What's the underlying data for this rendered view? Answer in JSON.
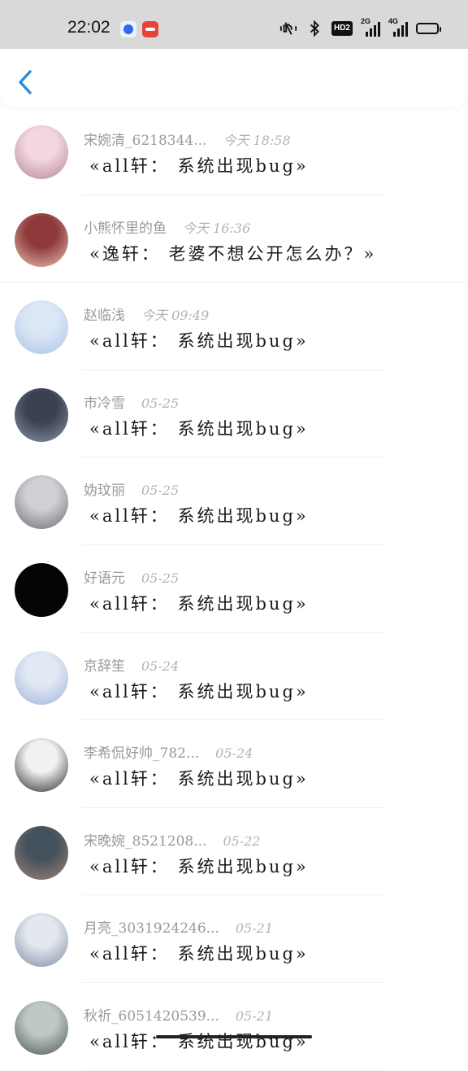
{
  "status": {
    "time": "22:02",
    "hd_label": "HD2",
    "net1_label": "2G",
    "net2_label": "4G"
  },
  "header": {
    "back_icon": "chevron-left-icon"
  },
  "items": [
    {
      "name": "宋婉清_6218344...",
      "time": "今天 18:58",
      "preview": "«all轩： 系统出现bug»",
      "avatar_colors": [
        "#f2d6e0",
        "#b58895"
      ]
    },
    {
      "name": "小熊怀里的鱼",
      "time": "今天 16:36",
      "preview": "«逸轩： 老婆不想公开怎么办？»",
      "avatar_colors": [
        "#8e3a3a",
        "#e9c3b5"
      ]
    },
    {
      "name": "赵临浅",
      "time": "今天 09:49",
      "preview": "«all轩： 系统出现bug»",
      "avatar_colors": [
        "#dbe7f7",
        "#aac4e6"
      ]
    },
    {
      "name": "市冷雪",
      "time": "05-25",
      "preview": "«all轩： 系统出现bug»",
      "avatar_colors": [
        "#3b4150",
        "#8895a6"
      ]
    },
    {
      "name": "妫玟丽",
      "time": "05-25",
      "preview": "«all轩： 系统出现bug»",
      "avatar_colors": [
        "#cfcfd4",
        "#6d6d76"
      ]
    },
    {
      "name": "好语元",
      "time": "05-25",
      "preview": "«all轩： 系统出现bug»",
      "avatar_colors": [
        "#050505",
        "#050505"
      ]
    },
    {
      "name": "京辞笙",
      "time": "05-24",
      "preview": "«all轩： 系统出现bug»",
      "avatar_colors": [
        "#e2e9f5",
        "#9fb3d6"
      ]
    },
    {
      "name": "李希侃好帅_782...",
      "time": "05-24",
      "preview": "«all轩： 系统出现bug»",
      "avatar_colors": [
        "#f1f1f1",
        "#2a2a2a"
      ]
    },
    {
      "name": "宋晚婉_8521208...",
      "time": "05-22",
      "preview": "«all轩： 系统出现bug»",
      "avatar_colors": [
        "#44525e",
        "#a08272"
      ]
    },
    {
      "name": "月亮_3031924246...",
      "time": "05-21",
      "preview": "«all轩： 系统出现bug»",
      "avatar_colors": [
        "#e3e7ee",
        "#7d8da1"
      ]
    },
    {
      "name": "秋祈_6051420539...",
      "time": "05-21",
      "preview": "«all轩： 系统出现bug»",
      "avatar_colors": [
        "#bfc8c6",
        "#4c5756"
      ]
    }
  ]
}
